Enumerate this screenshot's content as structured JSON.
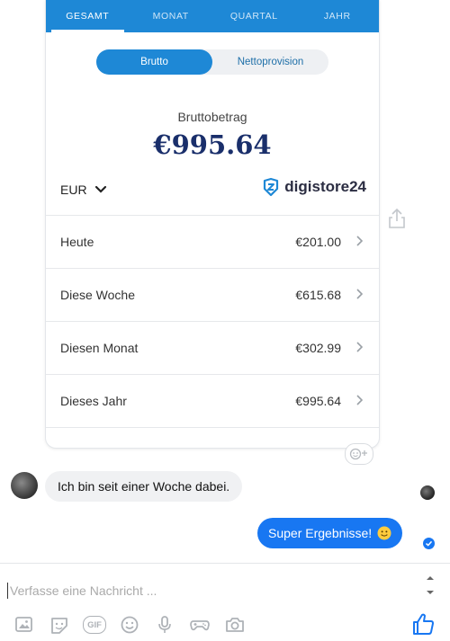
{
  "tabs": [
    "GESAMT",
    "MONAT",
    "QUARTAL",
    "JAHR"
  ],
  "active_tab": "GESAMT",
  "toggle": {
    "options": [
      "Brutto",
      "Nettoprovision"
    ],
    "selected": "Brutto"
  },
  "summary": {
    "label": "Bruttobetrag",
    "amount": "€995.64"
  },
  "currency": "EUR",
  "brand": {
    "name": "digistore24",
    "icon": "digistore-logo-icon"
  },
  "periods": [
    {
      "label": "Heute",
      "value": "€201.00"
    },
    {
      "label": "Diese Woche",
      "value": "€615.68"
    },
    {
      "label": "Diesen Monat",
      "value": "€302.99"
    },
    {
      "label": "Dieses Jahr",
      "value": "€995.64"
    }
  ],
  "messages": [
    {
      "direction": "in",
      "text": "Ich bin seit einer Woche dabei."
    },
    {
      "direction": "out",
      "text": "Super Ergebnisse!",
      "emoji": "slightly-smiling-face"
    }
  ],
  "composer": {
    "placeholder": "Verfasse eine Nachricht ..."
  },
  "toolbar": {
    "icons": [
      "image-icon",
      "sticker-icon",
      "gif-icon",
      "emoji-icon",
      "microphone-icon",
      "game-controller-icon",
      "camera-icon"
    ],
    "gif_label": "GIF"
  },
  "colors": {
    "accent": "#1e88d6",
    "amount": "#1a2f6b",
    "messenger_blue": "#1877f2"
  }
}
